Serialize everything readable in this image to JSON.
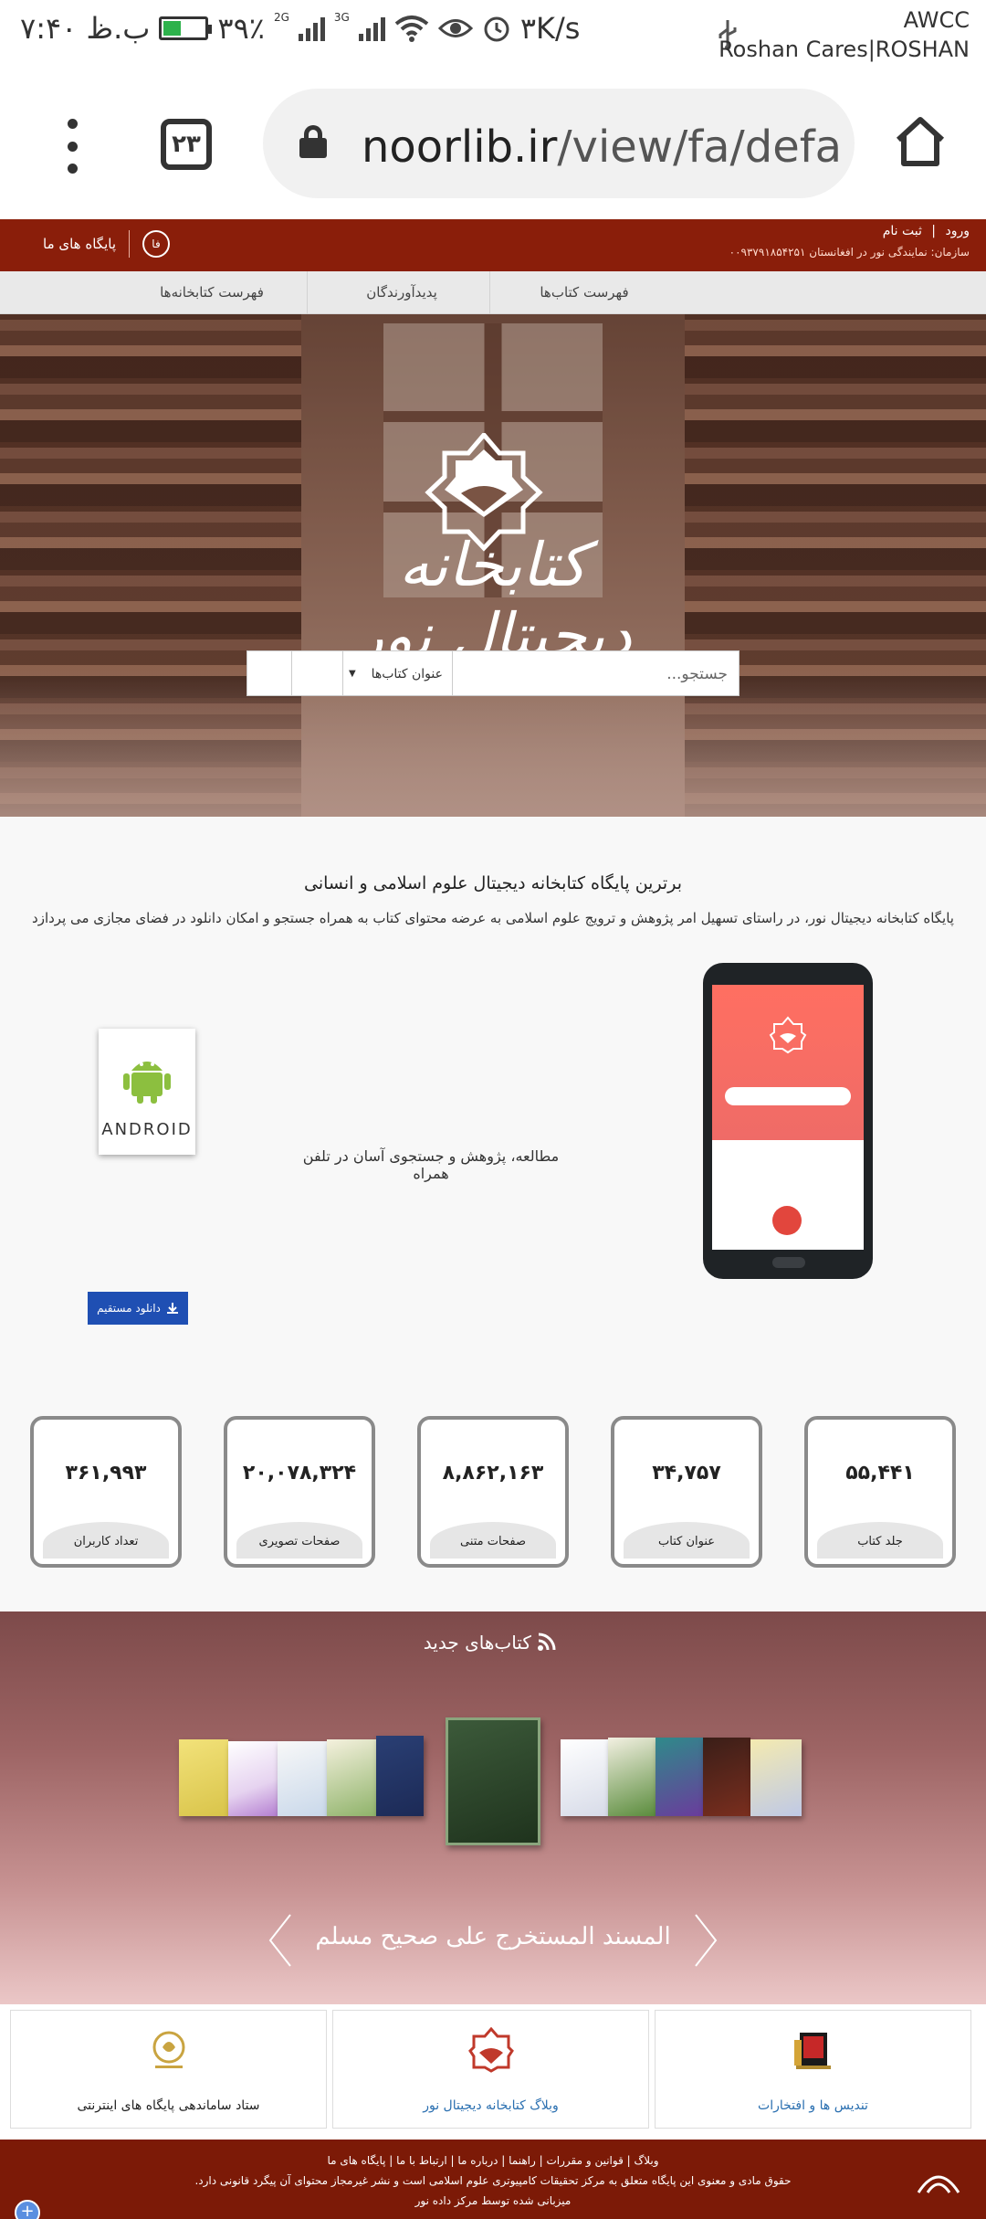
{
  "statusbar": {
    "time": "۷:۴۰ ب.ظ",
    "battery": "۳۹٪",
    "net_2g": "2G",
    "net_3g": "3G",
    "speed": "۳K/s",
    "carrier_1": "AWCC",
    "carrier_2": "Roshan Cares|ROSHAN",
    "battery_level": 0.39
  },
  "browser": {
    "tab_count": "۲۳",
    "url_domain": "noorlib.ir",
    "url_path": "/view/fa/defa"
  },
  "site_header": {
    "login": "ورود",
    "register": "ثبت نام",
    "separator": "|",
    "org": "سازمان: نمایندگی نور در افغانستان ۰۰۹۳۷۹۱۸۵۴۲۵۱",
    "lang": "فا",
    "databases": "پایگاه های ما"
  },
  "nav": {
    "items": [
      "فهرست کتاب‌ها",
      "پدیدآورندگان",
      "فهرست کتابخانه‌ها"
    ]
  },
  "hero": {
    "logo_text": "کتابخانه دیجیتال نور",
    "search_placeholder": "جستجو...",
    "search_category": "عنوان کتاب‌ها"
  },
  "intro": {
    "title": "برترین پایگاه کتابخانه دیجیتال علوم اسلامی و انسانی",
    "description": "پایگاه کتابخانه دیجیتال نور، در راستای تسهیل امر پژوهش و ترویج علوم اسلامی به عرضه محتوای کتاب به همراه جستجو و امکان دانلود در فضای مجازی می پردازد",
    "mobile_caption": "مطالعه، پژوهش و جستجوی آسان در تلفن همراه",
    "android_word": "ANDROID",
    "download_label": "دانلود مستقیم"
  },
  "stats": [
    {
      "value": "۵۵,۴۴۱",
      "label": "جلد کتاب"
    },
    {
      "value": "۳۴,۷۵۷",
      "label": "عنوان کتاب"
    },
    {
      "value": "۸,۸۶۲,۱۶۳",
      "label": "صفحات متنی"
    },
    {
      "value": "۲۰,۰۷۸,۳۲۴",
      "label": "صفحات تصویری"
    },
    {
      "value": "۳۶۱,۹۹۳",
      "label": "تعداد کاربران"
    }
  ],
  "new_books": {
    "title": "کتاب‌های جدید",
    "featured_title": "المسند المستخرج علی صحیح مسلم"
  },
  "cards": [
    {
      "label": "تندیس ها و افتخارات",
      "color": "#2a6fb0"
    },
    {
      "label": "وبلاگ کتابخانه دیجیتال نور",
      "color": "#2a6fb0"
    },
    {
      "label": "ستاد ساماندهی پایگاه های اینترنتی",
      "color": "#222222"
    }
  ],
  "footer": {
    "links": [
      "وبلاگ",
      "قوانین و مقررات",
      "راهنما",
      "درباره ما",
      "ارتباط با ما",
      "پایگاه های ما"
    ],
    "copyright": "حقوق مادی و معنوی این پایگاه متعلق به مرکز تحقیقات کامپیوتری علوم اسلامی است و نشر غیرمجاز محتوای آن پیگرد قانونی دارد.",
    "hosting": "میزبانی شده توسط مرکز داده نور"
  },
  "colors": {
    "brand_red": "#8a1e0a",
    "footer_red": "#7c1a07",
    "download_blue": "#1f4fb3"
  }
}
